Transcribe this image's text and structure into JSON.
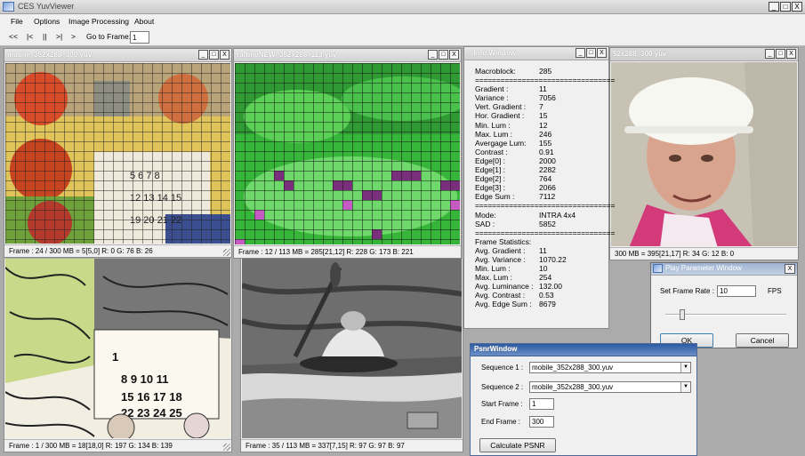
{
  "app": {
    "title": "CES YuvViewer"
  },
  "window_controls": [
    "_",
    "□",
    "X"
  ],
  "menu": [
    "File",
    "Options",
    "Image Processing",
    "About"
  ],
  "toolbar": {
    "first": "<<",
    "prev": "|<",
    "pause": "||",
    "next": ">|",
    "last": ">",
    "goto_label": "Go to Frame:",
    "goto_value": "1"
  },
  "windows": {
    "mobile": {
      "title": "mobile_352x288_300.yuv",
      "status": "Frame :  24 / 300   MB = 5[5,0]   R: 0 G: 76 B: 26"
    },
    "rafting": {
      "title": "raftingNEW_352x288_113.yuv",
      "status": "Frame :  12 / 113   MB = 285[21,12]   R: 228 G: 173 B: 221"
    },
    "face": {
      "title": "52x288_300.yuv",
      "status": "300   MB = 395[21,17]   R: 34 G: 12 B: 0"
    },
    "mobile_edge": {
      "status": "Frame :  1 / 300   MB = 18[18,0]   R: 197 G: 134 B: 139"
    },
    "rafting_gray": {
      "status": "Frame :  35 / 113   MB = 337[7,15]   R: 97 G: 97 B: 97"
    }
  },
  "info": {
    "title": ":: Info Window",
    "separator": "=================================",
    "macroblock": {
      "label": "Macroblock:",
      "value": "285"
    },
    "block_stats": [
      {
        "label": "Gradient :",
        "value": "11"
      },
      {
        "label": "Variance :",
        "value": "7056"
      },
      {
        "label": "Vert. Gradient :",
        "value": "7"
      },
      {
        "label": "Hor. Gradient :",
        "value": "15"
      },
      {
        "label": "Min. Lum :",
        "value": "12"
      },
      {
        "label": "Max. Lum :",
        "value": "246"
      },
      {
        "label": "Avergage Lum:",
        "value": "155"
      },
      {
        "label": "Contrast :",
        "value": "0.91"
      },
      {
        "label": "Edge[0] :",
        "value": "2000"
      },
      {
        "label": "Edge[1] :",
        "value": "2282"
      },
      {
        "label": "Edge[2] :",
        "value": "764"
      },
      {
        "label": "Edge[3] :",
        "value": "2066"
      },
      {
        "label": "Edge Sum :",
        "value": "7112"
      }
    ],
    "mode": {
      "label": "Mode:",
      "value": "INTRA 4x4"
    },
    "sad": {
      "label": "SAD :",
      "value": "5852"
    },
    "frame_stats_title": "Frame Statistics:",
    "frame_stats": [
      {
        "label": "Avg. Gradient :",
        "value": "11"
      },
      {
        "label": "Avg. Variance :",
        "value": "1070.22"
      },
      {
        "label": "Min. Lum :",
        "value": "10"
      },
      {
        "label": "Max. Lum :",
        "value": "254"
      },
      {
        "label": "Avg. Luminance :",
        "value": "132.00"
      },
      {
        "label": "Avg. Contrast :",
        "value": "0.53"
      },
      {
        "label": "Avg. Edge Sum :",
        "value": "8679"
      }
    ]
  },
  "play": {
    "title": "Play Parameter Window",
    "rate_label": "Set Frame Rate :",
    "rate_value": "10",
    "unit": "FPS",
    "slider_level": 0.12,
    "ok": "OK",
    "cancel": "Cancel",
    "close": "X"
  },
  "psnr": {
    "title": "PsnrWindow",
    "seq1_label": "Sequence 1 :",
    "seq1_value": "mobile_352x288_300.yuv",
    "seq2_label": "Sequence 2 :",
    "seq2_value": "mobile_352x288_300.yuv",
    "start_label": "Start Frame :",
    "start_value": "1",
    "end_label": "End Frame :",
    "end_value": "300",
    "calc": "Calculate PSNR",
    "dropdown_glyph": "▼"
  }
}
